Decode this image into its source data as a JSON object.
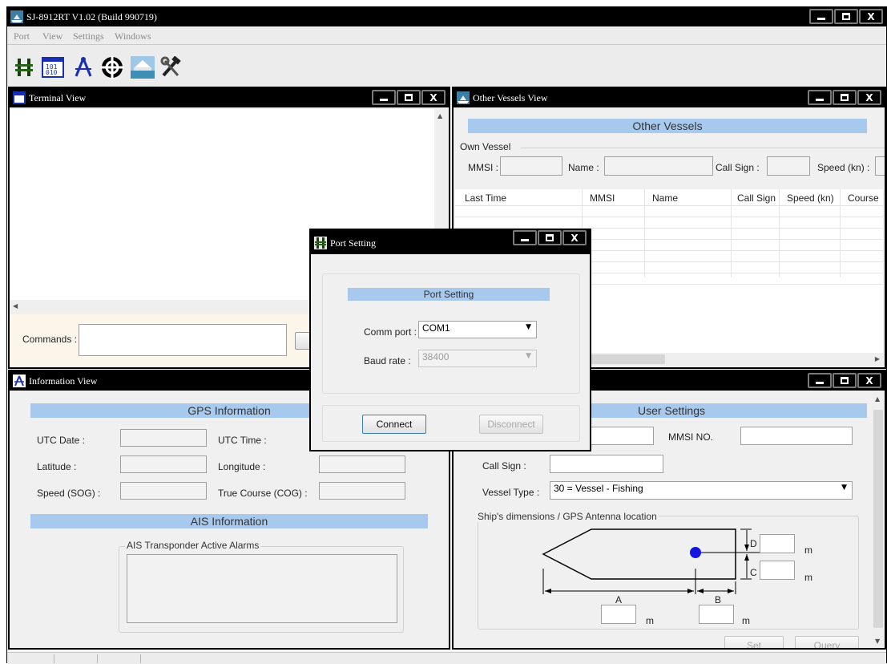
{
  "app": {
    "title": "SJ-8912RT V1.02 (Build 990719)"
  },
  "menu": [
    "Port",
    "View",
    "Settings",
    "Windows"
  ],
  "toolbar": {
    "icons": [
      "port-icon",
      "terminal-icon",
      "compass-icon",
      "target-icon",
      "vessel-icon",
      "tools-icon"
    ]
  },
  "terminal": {
    "title": "Terminal View",
    "commands_label": "Commands :",
    "commands_value": ""
  },
  "other_vessels": {
    "title": "Other Vessels View",
    "header": "Other Vessels",
    "own_vessel_label": "Own Vessel",
    "fields": {
      "mmsi": "MMSI :",
      "name": "Name :",
      "call_sign": "Call Sign :",
      "speed": "Speed (kn) :"
    },
    "columns": [
      "Last Time",
      "MMSI",
      "Name",
      "Call Sign",
      "Speed (kn)",
      "Course"
    ],
    "rows": []
  },
  "information": {
    "title": "Information View",
    "gps_header": "GPS Information",
    "labels": {
      "utc_date": "UTC Date :",
      "utc_time": "UTC Time :",
      "latitude": "Latitude :",
      "longitude": "Longitude :",
      "speed": "Speed (SOG) :",
      "course": "True Course (COG) :"
    },
    "ais_header": "AIS Information",
    "alarms_label": "AIS Transponder Active Alarms"
  },
  "user_settings": {
    "header": "User Settings",
    "mmsi_label": "MMSI NO.",
    "call_sign_label": "Call Sign :",
    "vessel_type_label": "Vessel Type :",
    "vessel_type_value": "30 = Vessel - Fishing",
    "dims_label": "Ship's dimensions / GPS Antenna location",
    "dim_a": "A",
    "dim_b": "B",
    "dim_c": "C",
    "dim_d": "D",
    "unit": "m",
    "set_label": "Set",
    "query_label": "Query"
  },
  "port_dialog": {
    "title": "Port Setting",
    "header": "Port Setting",
    "comm_port_label": "Comm port :",
    "comm_port_value": "COM1",
    "baud_rate_label": "Baud rate :",
    "baud_rate_value": "38400",
    "connect_label": "Connect",
    "disconnect_label": "Disconnect"
  },
  "colors": {
    "header_blue": "#a8c9ee",
    "titlebar": "#000000",
    "gps_dot": "#1515e0"
  }
}
